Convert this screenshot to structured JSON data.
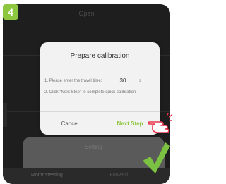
{
  "step": {
    "number": "4"
  },
  "background": {
    "title": "Open",
    "setting_label": "Setting",
    "motor_label": "Motor steering",
    "motor_value": "Forward"
  },
  "dialog": {
    "title": "Prepare calibration",
    "instruction1": "1. Please enter the travel time:",
    "travel_time": "30",
    "unit": "s",
    "instruction2": "2. Click \"Next Step\" to complete quick calibration",
    "cancel_label": "Cancel",
    "next_label": "Next Step"
  },
  "colors": {
    "accent": "#8dc63f",
    "dialog_bg": "#f2f2f2",
    "phone_bg": "#1e1e1e"
  },
  "icons": {
    "pointer": "hand-pointer-icon",
    "confirm": "checkmark-icon"
  }
}
